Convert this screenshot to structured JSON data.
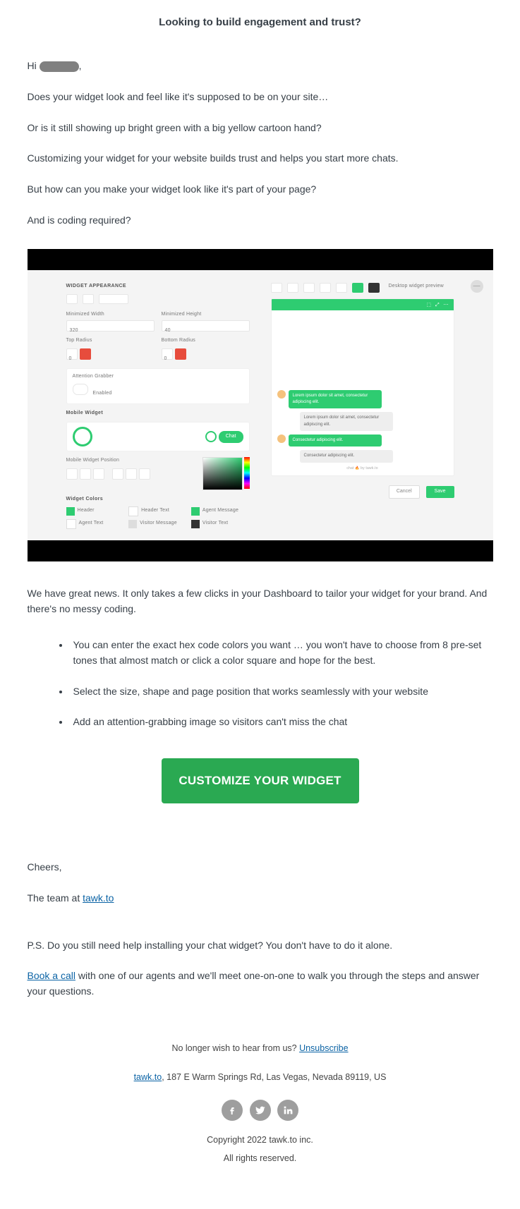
{
  "title": "Looking to build engagement and trust?",
  "greeting": "Hi ",
  "p1": "Does your widget look and feel like it's supposed to be on your site…",
  "p2": "Or is it still showing up bright green with a big yellow cartoon hand?",
  "p3": "Customizing your widget for your website builds trust and helps you start more chats.",
  "p4": "But how can you make your widget look like it's part of your page?",
  "p5": "And is coding required?",
  "shot": {
    "heading": "WIDGET APPEARANCE",
    "minw_label": "Minimized Width",
    "minw_val": "320",
    "minh_label": "Minimized Height",
    "minh_val": "40",
    "topr": "Top Radius",
    "botr": "Bottom Radius",
    "rval": "0",
    "att": "Attention Grabber",
    "enabled": "Enabled",
    "mob": "Mobile Widget",
    "chat": "Chat",
    "mwp": "Mobile Widget Position",
    "wc": "Widget Colors",
    "c_header": "Header",
    "c_htext": "Header Text",
    "c_amsg": "Agent Message",
    "c_atext": "Agent Text",
    "c_vmsg": "Visitor Message",
    "c_vtext": "Visitor Text",
    "prev": "Desktop widget preview",
    "m1": "Lorem ipsum dolor sit amet, consectetur adipiscing elit.",
    "m2": "Lorem ipsum dolor sit amet, consectetur adipiscing elit.",
    "m3": "Consectetur adipiscing elit.",
    "m4": "Consectetur adipiscing elit.",
    "foot": "chat 🔥 by tawk.to",
    "cancel": "Cancel",
    "save": "Save"
  },
  "p6": "We have great news. It only takes a few clicks in your Dashboard to tailor your widget for your brand. And there's no messy coding.",
  "b1": "You can enter the exact hex code colors you want … you won't have to choose from 8 pre-set tones that almost match or click a color square and hope for the best.",
  "b2": "Select the size, shape and page position that works seamlessly with your website",
  "b3": "Add an attention-grabbing image so visitors can't miss the chat",
  "cta": "CUSTOMIZE YOUR WIDGET",
  "cheers": "Cheers,",
  "team_pre": "The team at ",
  "team_link": "tawk.to",
  "ps": "P.S. Do you still need help installing your chat widget? You don't have to do it alone.",
  "book": "Book a call",
  "book_after": " with one of our agents and we'll meet one-on-one to walk you through the steps and answer your questions.",
  "unsub_pre": "No longer wish to hear from us? ",
  "unsub": "Unsubscribe",
  "addr_link": "tawk.to",
  "addr": ", 187 E Warm Springs Rd, Las Vegas, Nevada 89119, US",
  "copy": "Copyright 2022 tawk.to inc.",
  "rights": "All rights reserved."
}
